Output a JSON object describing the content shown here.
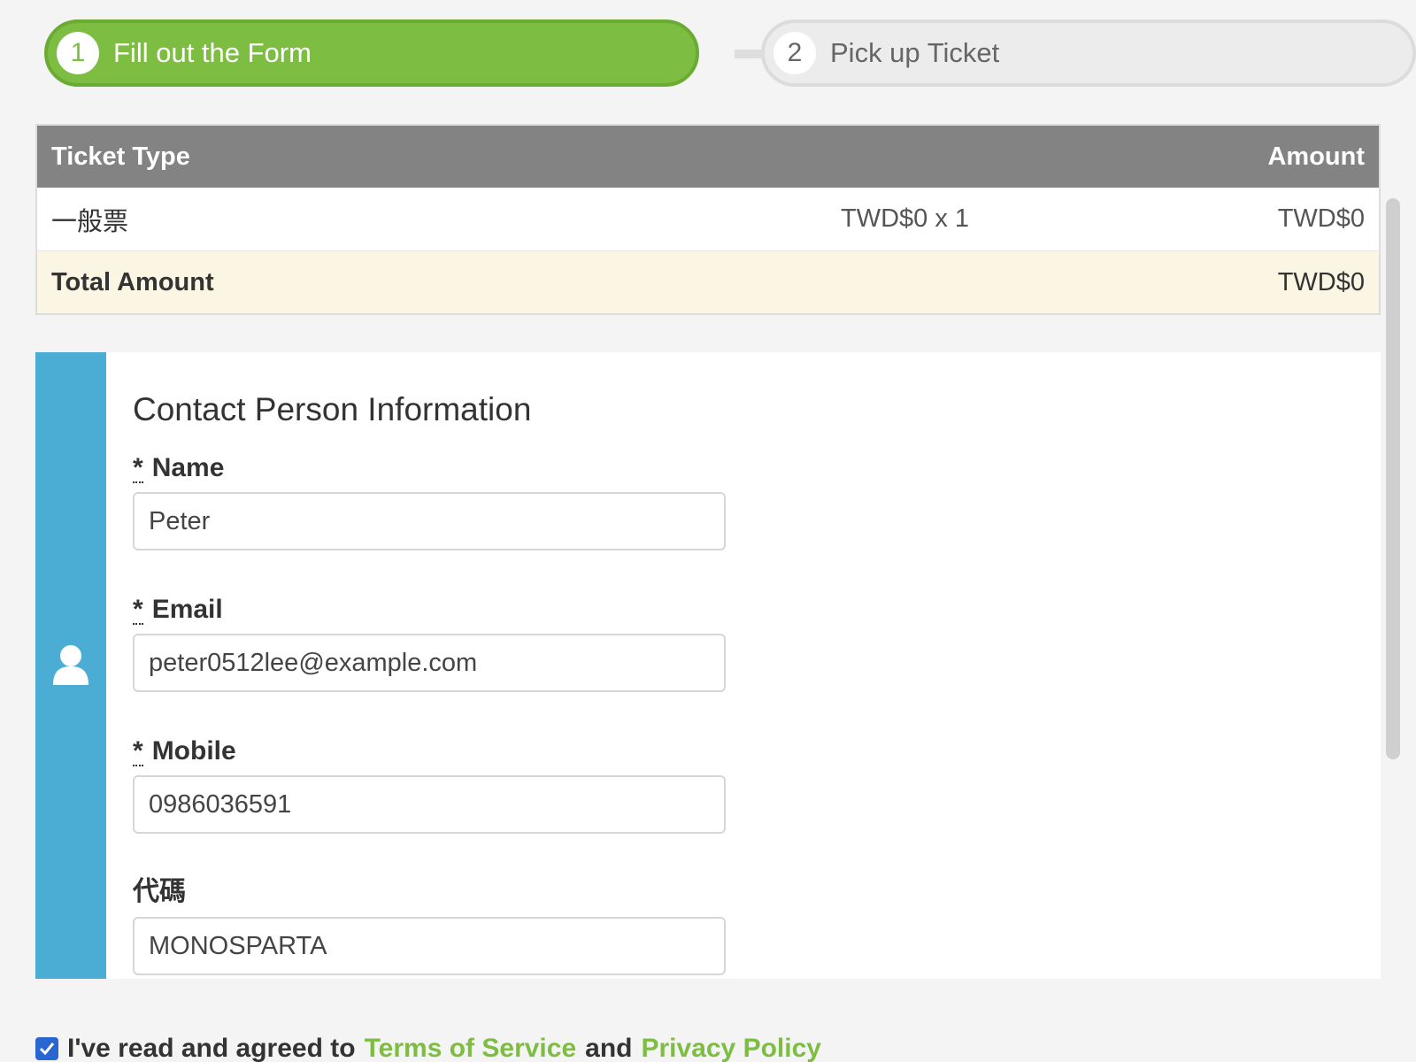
{
  "steps": [
    {
      "number": "1",
      "label": "Fill out the Form"
    },
    {
      "number": "2",
      "label": "Pick up Ticket"
    }
  ],
  "ticket_table": {
    "header": {
      "type": "Ticket Type",
      "amount": "Amount"
    },
    "rows": [
      {
        "type": "一般票",
        "qty": "TWD$0 x 1",
        "amount": "TWD$0"
      }
    ],
    "total": {
      "label": "Total Amount",
      "value": "TWD$0"
    }
  },
  "contact": {
    "title": "Contact Person Information",
    "required_mark": "*",
    "fields": {
      "name": {
        "label": "Name",
        "value": "Peter"
      },
      "email": {
        "label": "Email",
        "value": "peter0512lee@example.com"
      },
      "mobile": {
        "label": "Mobile",
        "value": "0986036591"
      },
      "code": {
        "label": "代碼",
        "value": "MONOSPARTA"
      }
    },
    "icon": "user-icon"
  },
  "agreement": {
    "prefix": "I've read and agreed to",
    "terms": "Terms of Service",
    "conj": "and",
    "privacy": "Privacy Policy",
    "checked": true
  },
  "colors": {
    "accent_green": "#7dbd42",
    "side_blue": "#4badd4",
    "header_gray": "#838383",
    "total_bg": "#fbf6e3"
  }
}
